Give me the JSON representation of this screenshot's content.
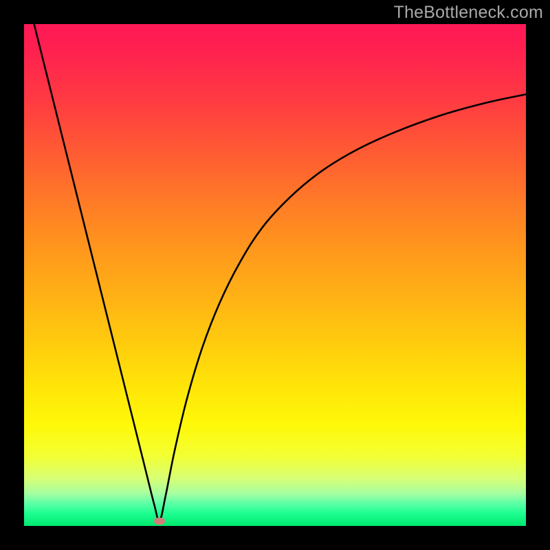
{
  "watermark": "TheBottleneck.com",
  "colors": {
    "frame": "#000000",
    "marker": "#cf7f79",
    "curve_stroke": "#000000",
    "gradient_stops": [
      {
        "offset": 0.0,
        "color": "#ff1856"
      },
      {
        "offset": 0.05,
        "color": "#ff2050"
      },
      {
        "offset": 0.15,
        "color": "#ff3a42"
      },
      {
        "offset": 0.28,
        "color": "#ff6330"
      },
      {
        "offset": 0.42,
        "color": "#ff8f1f"
      },
      {
        "offset": 0.58,
        "color": "#ffbc12"
      },
      {
        "offset": 0.72,
        "color": "#ffe408"
      },
      {
        "offset": 0.8,
        "color": "#fff90a"
      },
      {
        "offset": 0.86,
        "color": "#f3ff33"
      },
      {
        "offset": 0.905,
        "color": "#d8ff74"
      },
      {
        "offset": 0.935,
        "color": "#a7ffa1"
      },
      {
        "offset": 0.955,
        "color": "#5dffa7"
      },
      {
        "offset": 0.975,
        "color": "#1dff90"
      },
      {
        "offset": 1.0,
        "color": "#00e86f"
      }
    ]
  },
  "chart_data": {
    "type": "line",
    "title": "",
    "xlabel": "",
    "ylabel": "",
    "xlim": [
      0,
      100
    ],
    "ylim": [
      0,
      100
    ],
    "marker": {
      "x": 27,
      "y": 1
    },
    "left_branch": {
      "description": "near-linear descent from top-left to minimum",
      "x": [
        2.0,
        5.0,
        9.0,
        13.0,
        17.0,
        21.0,
        24.0,
        26.0,
        27.0
      ],
      "y": [
        100.0,
        88.0,
        72.0,
        56.0,
        40.0,
        24.0,
        12.0,
        4.0,
        1.0
      ]
    },
    "right_branch": {
      "description": "steep rise out of minimum then decelerating toward upper-right",
      "x": [
        27.0,
        28.2,
        30.0,
        32.5,
        35.5,
        39.0,
        43.0,
        47.5,
        53.0,
        59.0,
        66.0,
        74.0,
        83.0,
        92.0,
        100.0
      ],
      "y": [
        1.0,
        6.0,
        15.0,
        25.5,
        35.5,
        44.5,
        52.5,
        59.5,
        65.5,
        70.5,
        74.8,
        78.5,
        81.8,
        84.3,
        86.0
      ]
    }
  }
}
